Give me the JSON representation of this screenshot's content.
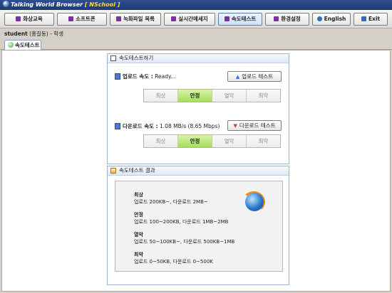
{
  "window": {
    "title_prefix": "Talking World Browser",
    "title_accent": "[ NSchool ]"
  },
  "toolbar": {
    "buttons": [
      "화상교육",
      "소프트폰",
      "녹화파일 목록",
      "실시간메세지",
      "속도테스트",
      "환경설정",
      "English",
      "Exit"
    ],
    "active_index": 4
  },
  "user": {
    "name": "student",
    "paren": "(홍길동)",
    "sep": "-",
    "role": "학생"
  },
  "tab": {
    "label": "속도테스트"
  },
  "speed_panel": {
    "title": "속도테스트하기",
    "upload": {
      "label": "업로드 속도 :",
      "value": "Ready...",
      "button": "업로드 테스트"
    },
    "download": {
      "label": "다운로드 속도 :",
      "value": "1.08 MB/s (8.65 Mbps)",
      "button": "다운로드 테스트"
    },
    "levels": [
      "최상",
      "안정",
      "열악",
      "최악"
    ],
    "upload_level_index": 1,
    "download_level_index": 1
  },
  "result_panel": {
    "title": "속도테스트 결과",
    "items": [
      {
        "title": "최상",
        "desc": "업로드 200KB~, 다운로드 2MB~"
      },
      {
        "title": "안정",
        "desc": "업로드 100~200KB, 다운로드 1MB~2MB"
      },
      {
        "title": "열악",
        "desc": "업로드 50~100KB~, 다운로드 500KB~1MB"
      },
      {
        "title": "최악",
        "desc": "업로드 0~50KB, 다운로드 0~500K"
      }
    ]
  },
  "colors": {
    "active_level": "#a6dd5b",
    "title_bar": "#1d3a73",
    "accent": "#ffd84a"
  }
}
